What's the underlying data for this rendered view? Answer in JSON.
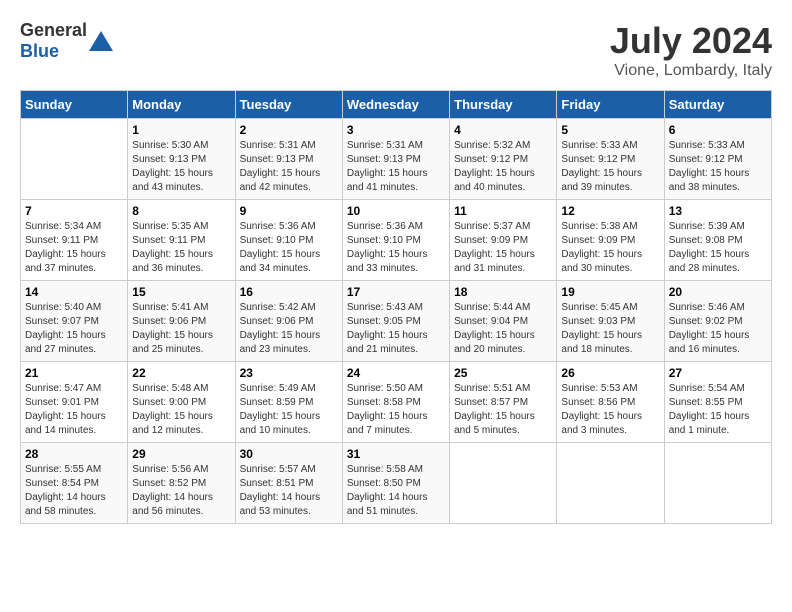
{
  "header": {
    "logo_general": "General",
    "logo_blue": "Blue",
    "title": "July 2024",
    "subtitle": "Vione, Lombardy, Italy"
  },
  "calendar": {
    "days_of_week": [
      "Sunday",
      "Monday",
      "Tuesday",
      "Wednesday",
      "Thursday",
      "Friday",
      "Saturday"
    ],
    "weeks": [
      [
        {
          "day": "",
          "info": ""
        },
        {
          "day": "1",
          "info": "Sunrise: 5:30 AM\nSunset: 9:13 PM\nDaylight: 15 hours\nand 43 minutes."
        },
        {
          "day": "2",
          "info": "Sunrise: 5:31 AM\nSunset: 9:13 PM\nDaylight: 15 hours\nand 42 minutes."
        },
        {
          "day": "3",
          "info": "Sunrise: 5:31 AM\nSunset: 9:13 PM\nDaylight: 15 hours\nand 41 minutes."
        },
        {
          "day": "4",
          "info": "Sunrise: 5:32 AM\nSunset: 9:12 PM\nDaylight: 15 hours\nand 40 minutes."
        },
        {
          "day": "5",
          "info": "Sunrise: 5:33 AM\nSunset: 9:12 PM\nDaylight: 15 hours\nand 39 minutes."
        },
        {
          "day": "6",
          "info": "Sunrise: 5:33 AM\nSunset: 9:12 PM\nDaylight: 15 hours\nand 38 minutes."
        }
      ],
      [
        {
          "day": "7",
          "info": "Sunrise: 5:34 AM\nSunset: 9:11 PM\nDaylight: 15 hours\nand 37 minutes."
        },
        {
          "day": "8",
          "info": "Sunrise: 5:35 AM\nSunset: 9:11 PM\nDaylight: 15 hours\nand 36 minutes."
        },
        {
          "day": "9",
          "info": "Sunrise: 5:36 AM\nSunset: 9:10 PM\nDaylight: 15 hours\nand 34 minutes."
        },
        {
          "day": "10",
          "info": "Sunrise: 5:36 AM\nSunset: 9:10 PM\nDaylight: 15 hours\nand 33 minutes."
        },
        {
          "day": "11",
          "info": "Sunrise: 5:37 AM\nSunset: 9:09 PM\nDaylight: 15 hours\nand 31 minutes."
        },
        {
          "day": "12",
          "info": "Sunrise: 5:38 AM\nSunset: 9:09 PM\nDaylight: 15 hours\nand 30 minutes."
        },
        {
          "day": "13",
          "info": "Sunrise: 5:39 AM\nSunset: 9:08 PM\nDaylight: 15 hours\nand 28 minutes."
        }
      ],
      [
        {
          "day": "14",
          "info": "Sunrise: 5:40 AM\nSunset: 9:07 PM\nDaylight: 15 hours\nand 27 minutes."
        },
        {
          "day": "15",
          "info": "Sunrise: 5:41 AM\nSunset: 9:06 PM\nDaylight: 15 hours\nand 25 minutes."
        },
        {
          "day": "16",
          "info": "Sunrise: 5:42 AM\nSunset: 9:06 PM\nDaylight: 15 hours\nand 23 minutes."
        },
        {
          "day": "17",
          "info": "Sunrise: 5:43 AM\nSunset: 9:05 PM\nDaylight: 15 hours\nand 21 minutes."
        },
        {
          "day": "18",
          "info": "Sunrise: 5:44 AM\nSunset: 9:04 PM\nDaylight: 15 hours\nand 20 minutes."
        },
        {
          "day": "19",
          "info": "Sunrise: 5:45 AM\nSunset: 9:03 PM\nDaylight: 15 hours\nand 18 minutes."
        },
        {
          "day": "20",
          "info": "Sunrise: 5:46 AM\nSunset: 9:02 PM\nDaylight: 15 hours\nand 16 minutes."
        }
      ],
      [
        {
          "day": "21",
          "info": "Sunrise: 5:47 AM\nSunset: 9:01 PM\nDaylight: 15 hours\nand 14 minutes."
        },
        {
          "day": "22",
          "info": "Sunrise: 5:48 AM\nSunset: 9:00 PM\nDaylight: 15 hours\nand 12 minutes."
        },
        {
          "day": "23",
          "info": "Sunrise: 5:49 AM\nSunset: 8:59 PM\nDaylight: 15 hours\nand 10 minutes."
        },
        {
          "day": "24",
          "info": "Sunrise: 5:50 AM\nSunset: 8:58 PM\nDaylight: 15 hours\nand 7 minutes."
        },
        {
          "day": "25",
          "info": "Sunrise: 5:51 AM\nSunset: 8:57 PM\nDaylight: 15 hours\nand 5 minutes."
        },
        {
          "day": "26",
          "info": "Sunrise: 5:53 AM\nSunset: 8:56 PM\nDaylight: 15 hours\nand 3 minutes."
        },
        {
          "day": "27",
          "info": "Sunrise: 5:54 AM\nSunset: 8:55 PM\nDaylight: 15 hours\nand 1 minute."
        }
      ],
      [
        {
          "day": "28",
          "info": "Sunrise: 5:55 AM\nSunset: 8:54 PM\nDaylight: 14 hours\nand 58 minutes."
        },
        {
          "day": "29",
          "info": "Sunrise: 5:56 AM\nSunset: 8:52 PM\nDaylight: 14 hours\nand 56 minutes."
        },
        {
          "day": "30",
          "info": "Sunrise: 5:57 AM\nSunset: 8:51 PM\nDaylight: 14 hours\nand 53 minutes."
        },
        {
          "day": "31",
          "info": "Sunrise: 5:58 AM\nSunset: 8:50 PM\nDaylight: 14 hours\nand 51 minutes."
        },
        {
          "day": "",
          "info": ""
        },
        {
          "day": "",
          "info": ""
        },
        {
          "day": "",
          "info": ""
        }
      ]
    ]
  }
}
